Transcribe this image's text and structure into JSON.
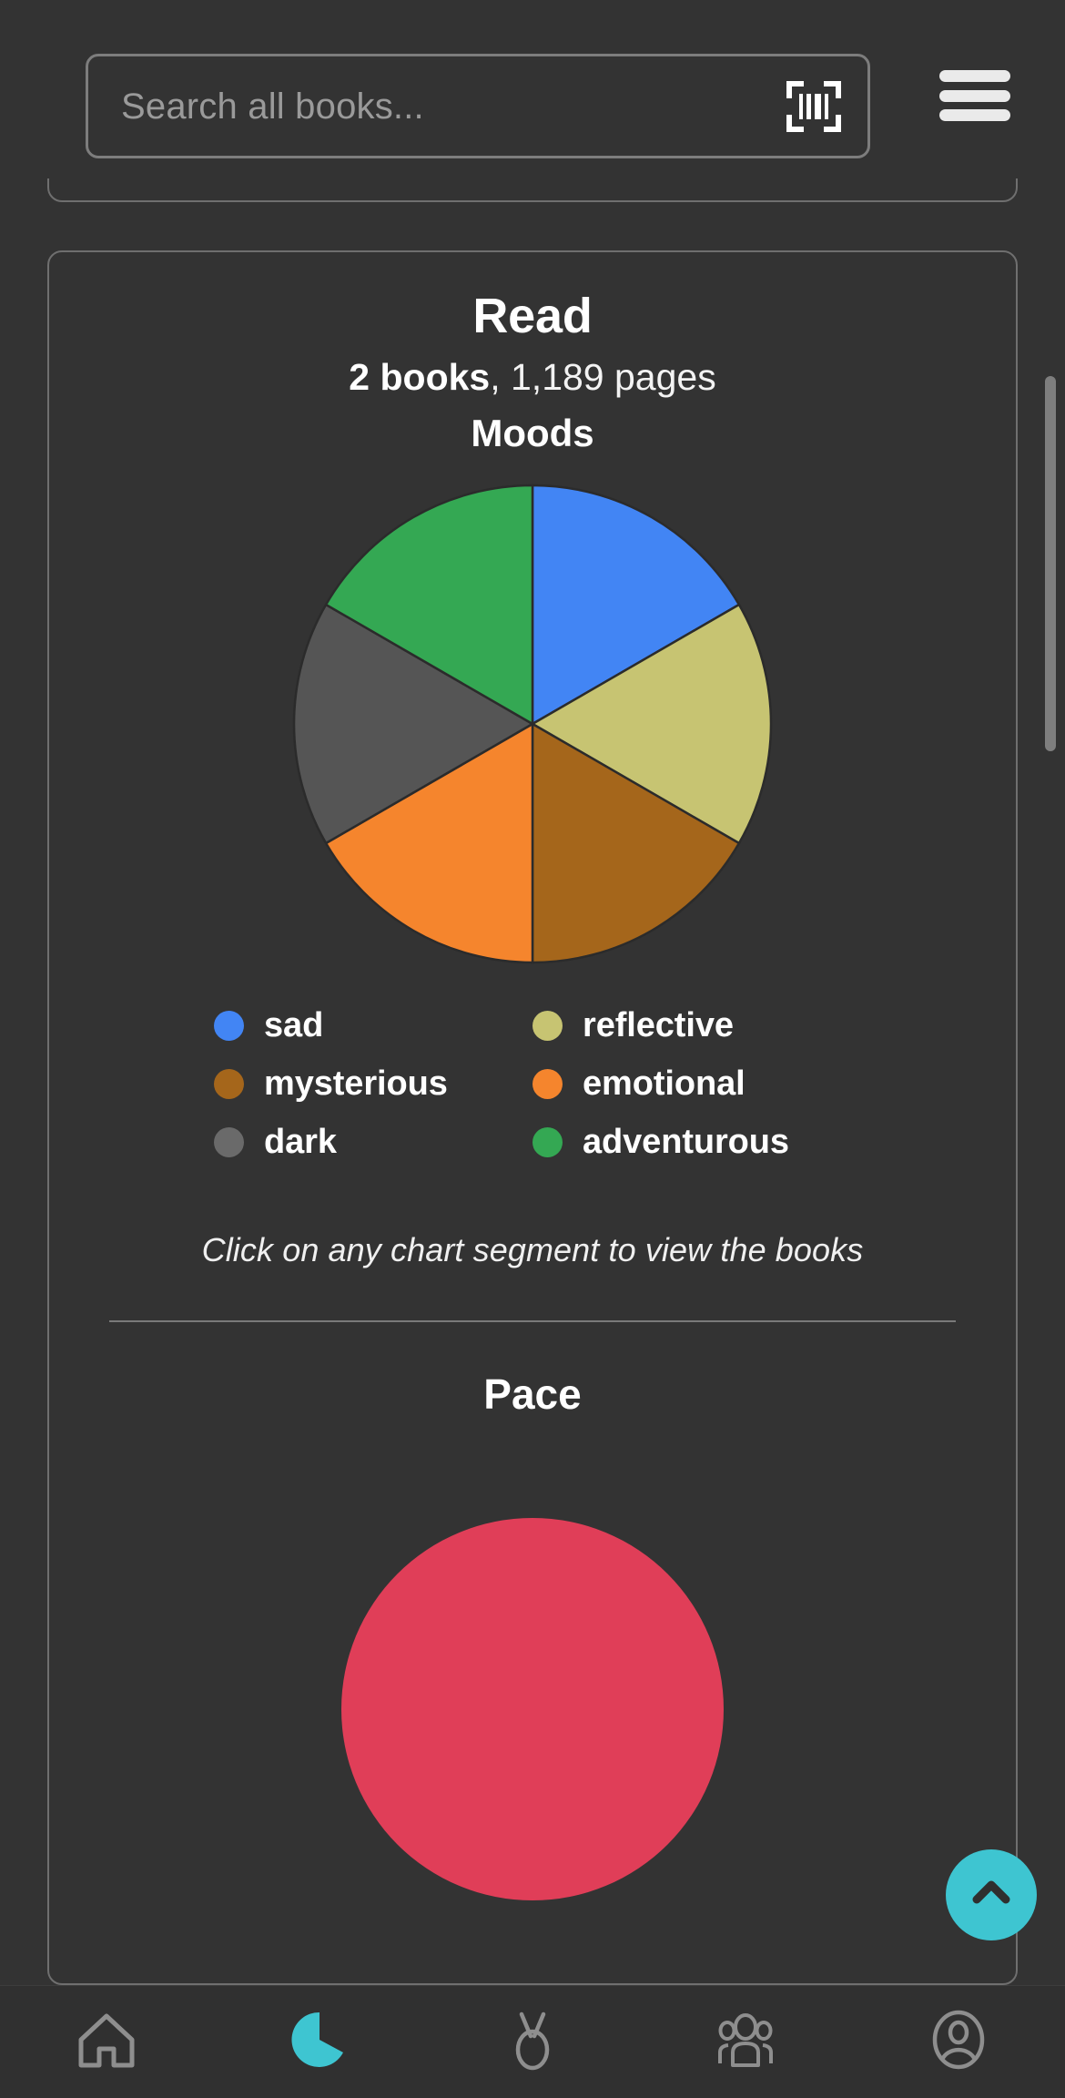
{
  "header": {
    "search_placeholder": "Search all books...",
    "scan_icon": "barcode-scan-icon",
    "menu_icon": "hamburger-menu-icon"
  },
  "card": {
    "title": "Read",
    "stats_books": "2 books",
    "stats_rest": ", 1,189 pages",
    "moods_heading": "Moods",
    "hint": "Click on any chart segment to view the books",
    "pace_heading": "Pace"
  },
  "chart_data": {
    "type": "pie",
    "title": "Moods",
    "categories": [
      "sad",
      "reflective",
      "mysterious",
      "emotional",
      "dark",
      "adventurous"
    ],
    "values": [
      1,
      1,
      1,
      1,
      1,
      1
    ],
    "percentages": [
      16.7,
      16.7,
      16.7,
      16.7,
      16.7,
      16.7
    ],
    "colors": [
      "#4285f4",
      "#c7c472",
      "#a5661b",
      "#f5852d",
      "#555555",
      "#34a853"
    ],
    "legend_colors": [
      "#4285f4",
      "#c7c472",
      "#a5661b",
      "#f5852d",
      "#6a6a6a",
      "#34a853"
    ],
    "legend_position": "below",
    "start_angle_deg": 0,
    "direction": "clockwise",
    "stroke": "#2b2b2b",
    "legend": [
      {
        "label": "sad",
        "color": "#4285f4"
      },
      {
        "label": "reflective",
        "color": "#c7c472"
      },
      {
        "label": "mysterious",
        "color": "#a5661b"
      },
      {
        "label": "emotional",
        "color": "#f5852d"
      },
      {
        "label": "dark",
        "color": "#6a6a6a"
      },
      {
        "label": "adventurous",
        "color": "#34a853"
      }
    ]
  },
  "pace_chart": {
    "type": "pie",
    "title": "Pace",
    "visible_color": "#e03e58",
    "note": "partially visible below the fold"
  },
  "fab": {
    "icon": "chevron-up-icon",
    "color": "#3ec5d1"
  },
  "bottom_nav": {
    "items": [
      {
        "name": "home-icon",
        "active": false
      },
      {
        "name": "stats-pie-icon",
        "active": true
      },
      {
        "name": "medal-icon",
        "active": false
      },
      {
        "name": "community-icon",
        "active": false
      },
      {
        "name": "profile-icon",
        "active": false
      }
    ],
    "active_color": "#3ec5d1",
    "inactive_color": "#8e8e8e"
  },
  "theme": {
    "background": "#333333",
    "card_border": "#6f6f6f",
    "text": "#ffffff",
    "muted_text": "#9a9a9a",
    "accent": "#3ec5d1"
  }
}
